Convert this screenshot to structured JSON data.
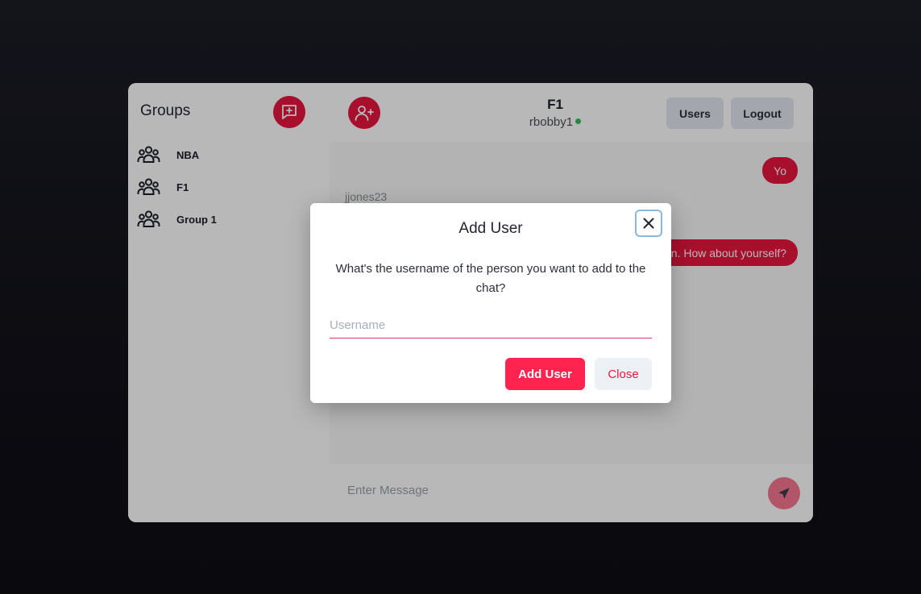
{
  "sidebar": {
    "title": "Groups",
    "new_group_icon": "message-plus-icon",
    "groups": [
      {
        "name": "NBA",
        "icon": "group-icon"
      },
      {
        "name": "F1",
        "icon": "group-icon"
      },
      {
        "name": "Group 1",
        "icon": "group-icon"
      }
    ]
  },
  "header": {
    "add_user_icon": "user-plus-icon",
    "chat_title": "F1",
    "current_user": "rbobby1",
    "online_status_color": "#2fbf5b",
    "users_label": "Users",
    "logout_label": "Logout"
  },
  "messages": [
    {
      "from": "self",
      "text": "Yo"
    },
    {
      "from": "jjones23",
      "sender_label": "jjones23",
      "text": ""
    },
    {
      "from": "self",
      "text": "n. How about yourself?"
    }
  ],
  "composer": {
    "placeholder": "Enter Message",
    "send_icon": "send-icon"
  },
  "modal": {
    "title": "Add User",
    "description": "What's the username of the person you want to add to the chat?",
    "input_placeholder": "Username",
    "input_value": "",
    "primary_label": "Add User",
    "secondary_label": "Close",
    "close_icon": "close-icon"
  },
  "colors": {
    "accent": "#e8163f",
    "primary_button": "#ff2350",
    "secondary_button_bg": "#edf1f6",
    "header_button_bg": "#e2e8f0"
  }
}
